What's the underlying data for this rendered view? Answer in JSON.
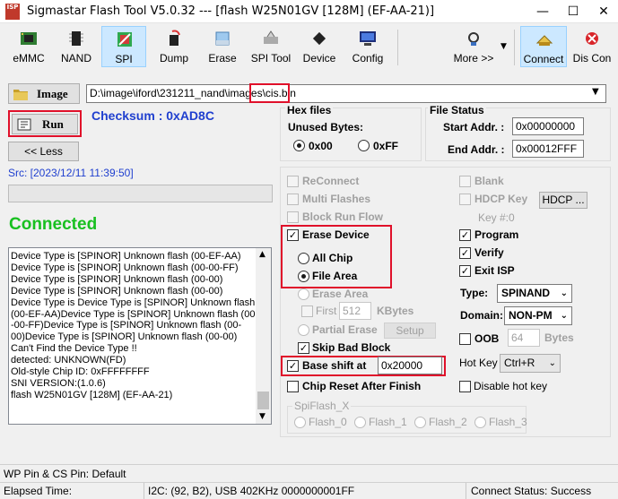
{
  "window": {
    "logo": "ISP",
    "title": "Sigmastar Flash Tool V5.0.32 --- [flash W25N01GV [128M] (EF-AA-21)]",
    "minimize": "—",
    "maximize": "☐",
    "close": "✕"
  },
  "toolbar": {
    "items": [
      {
        "label": "eMMC",
        "icon": "chip-board-icon"
      },
      {
        "label": "NAND",
        "icon": "chip-icon"
      },
      {
        "label": "SPI",
        "icon": "spi-chip-icon"
      },
      {
        "label": "Dump",
        "icon": "dump-icon"
      },
      {
        "label": "Erase",
        "icon": "eraser-icon"
      },
      {
        "label": "SPI Tool",
        "icon": "spi-tool-icon"
      },
      {
        "label": "Device",
        "icon": "device-chip-icon"
      },
      {
        "label": "Config",
        "icon": "monitor-icon"
      },
      {
        "label": "More >>",
        "icon": "satellite-icon"
      },
      {
        "label": "Connect",
        "icon": "connect-icon"
      },
      {
        "label": "Dis Con",
        "icon": "disconnect-icon"
      }
    ]
  },
  "image": {
    "button_label": "Image",
    "path": "D:\\image\\iford\\231211_nand\\images\\cis.bin"
  },
  "run_label": "Run",
  "checksum": "Checksum : 0xAD8C",
  "less_label": "<< Less",
  "src_time": "Src: [2023/12/11 11:39:50]",
  "connected": "Connected",
  "hex_files": {
    "title": "Hex files",
    "unused_label": "Unused Bytes:",
    "opt1": "0x00",
    "opt2": "0xFF"
  },
  "file_status": {
    "title": "File Status",
    "start_label": "Start Addr. :",
    "start_value": "0x00000000",
    "end_label": "End Addr. :",
    "end_value": "0x00012FFF"
  },
  "log": [
    "Device Type is [SPINOR] Unknown flash (00-EF-AA)",
    "Device Type is [SPINOR] Unknown flash (00-00-FF)",
    "Device Type is [SPINOR] Unknown flash (00-00)",
    "Device Type is [SPINOR] Unknown flash (00-00)",
    "Device Type is Device Type is [SPINOR] Unknown flash",
    "(00-EF-AA)Device Type is [SPINOR] Unknown flash (00",
    "-00-FF)Device Type is [SPINOR] Unknown flash (00-",
    "00)Device Type is [SPINOR] Unknown flash (00-00)",
    "Can't Find the Device Type !!",
    "detected: UNKNOWN(FD)",
    "Old-style Chip ID: 0xFFFFFFFF",
    "SNI VERSION:(1.0.6)",
    "flash W25N01GV [128M] (EF-AA-21)"
  ],
  "options": {
    "reconnect": "ReConnect",
    "multi_flashes": "Multi Flashes",
    "block_run_flow": "Block Run Flow",
    "erase_device": "Erase Device",
    "all_chip": "All Chip",
    "file_area": "File Area",
    "erase_area": "Erase Area",
    "first": "First",
    "first_value": "512",
    "kbytes": "KBytes",
    "partial_erase": "Partial Erase",
    "setup": "Setup",
    "skip_bad_block": "Skip Bad Block",
    "base_shift_at": "Base shift at",
    "base_shift_value": "0x20000",
    "chip_reset": "Chip Reset After Finish"
  },
  "right_options": {
    "blank": "Blank",
    "hdcp_key": "HDCP Key",
    "hdcp_btn": "HDCP ...",
    "key_num": "Key #:0",
    "program": "Program",
    "verify": "Verify",
    "exit_isp": "Exit ISP",
    "type_label": "Type:",
    "type_value": "SPINAND",
    "domain_label": "Domain:",
    "domain_value": "NON-PM",
    "oob": "OOB",
    "oob_value": "64",
    "bytes": "Bytes",
    "hotkey_label": "Hot Key",
    "hotkey_value": "Ctrl+R",
    "disable_hotkey": "Disable hot key"
  },
  "spiflash": {
    "title": "SpiFlash_X",
    "items": [
      "Flash_0",
      "Flash_1",
      "Flash_2",
      "Flash_3"
    ]
  },
  "status": {
    "wp_pin": "WP Pin & CS Pin: Default",
    "elapsed": "Elapsed Time:",
    "i2c": "I2C: (92, B2), USB  402KHz  0000000001FF",
    "connect_status": "Connect Status: Success"
  },
  "colors": {
    "checksum": "#1f3fcf",
    "connected": "#18c020",
    "highlight_box": "#e0102a",
    "src_time": "#1f3fcf"
  }
}
